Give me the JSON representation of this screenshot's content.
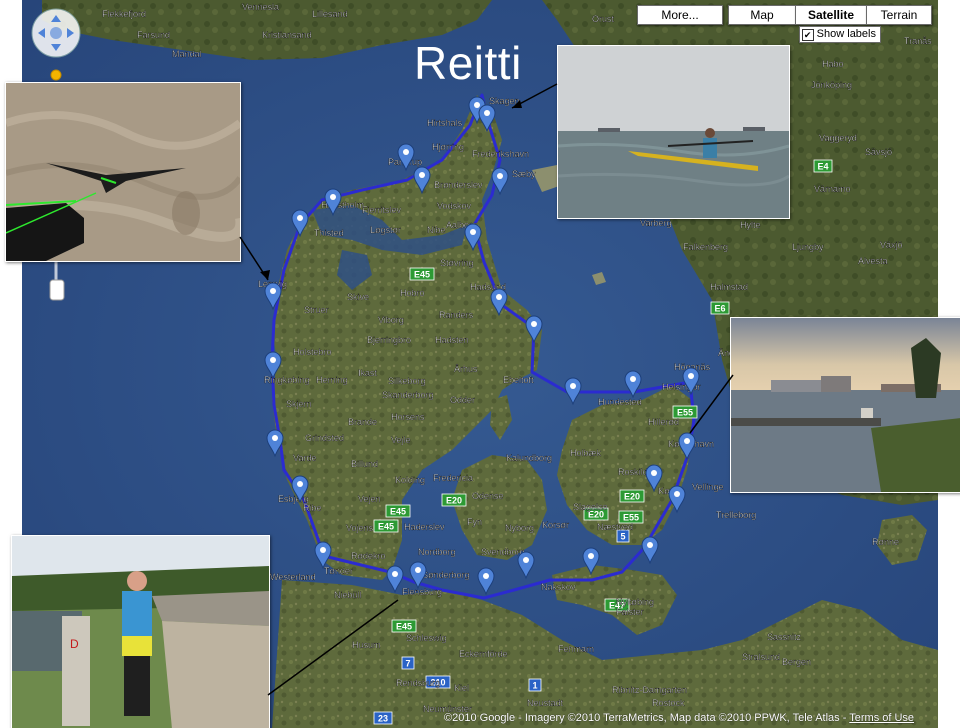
{
  "title": "Reitti",
  "map_controls": {
    "more_label": "More...",
    "map_label": "Map",
    "satellite_label": "Satellite",
    "terrain_label": "Terrain",
    "show_labels_label": "Show labels",
    "show_labels_checked": true,
    "active_type": "Satellite"
  },
  "attribution": {
    "text": "©2010 Google - Imagery ©2010 TerraMetrics, Map data ©2010 PPWK, Tele Atlas - ",
    "terms_link": "Terms of Use"
  },
  "colors": {
    "route": "#2222cc",
    "marker": "#4f83d8",
    "sea": "#2e4f86",
    "land": "#5f6b3c"
  },
  "places": {
    "skagen": "Skagen",
    "hirtshals": "Hirtshals",
    "hjorring": "Hjørring",
    "frederikshavn": "Frederikshavn",
    "saeby": "Sæby",
    "pandrup": "Pandrup",
    "bronderslev": "Brønderslev",
    "vodskov": "Vodskov",
    "aalborg": "Aalborg",
    "fjerritslev": "Fjerritslev",
    "hanstholm": "Hanstholm",
    "thisted": "Thisted",
    "logstor": "Løgstør",
    "nibe": "Nibe",
    "stovring": "Støvring",
    "hadsund": "Hadsund",
    "lemvig": "Lemvig",
    "struer": "Struer",
    "skive": "Skive",
    "hobro": "Hobro",
    "randers": "Randers",
    "holstebro": "Holstebro",
    "viborg": "Viborg",
    "bjerringbro": "Bjerringbro",
    "hadsten": "Hadsten",
    "ringkobing": "Ringkøbing",
    "herning": "Herning",
    "ikast": "Ikast",
    "silkeborg": "Silkeborg",
    "arhus": "Århus",
    "ebeltoft": "Ebeltoft",
    "skjern": "Skjern",
    "skanderborg": "Skanderborg",
    "odder": "Odder",
    "horsens": "Horsens",
    "brande": "Brande",
    "grindsted": "Grindsted",
    "vejle": "Vejle",
    "varde": "Varde",
    "billund": "Billund",
    "kolding": "Kolding",
    "fredericia": "Fredericia",
    "esbjerg": "Esbjerg",
    "ribe": "Ribe",
    "vejen": "Vejen",
    "vojens": "Vojens",
    "haderslev": "Haderslev",
    "odense": "Odense",
    "fyn": "Fyn",
    "nyborg": "Nyborg",
    "svendborg": "Svendborg",
    "nordborg": "Nordborg",
    "sonderborg": "Sønderborg",
    "rodekro": "Rødekro",
    "tonder": "Tønder",
    "westerland": "Westerland",
    "niebull": "Niebüll",
    "flensburg": "Flensburg",
    "schleswig": "Schleswig",
    "husum": "Husum",
    "eckernforde": "Eckernförde",
    "kiel": "Kiel",
    "rendsburg": "Rendsburg",
    "neumunster": "Neumünster",
    "fehmarn": "Fehmarn",
    "neustadt": "Neustadt",
    "rostock": "Rostock",
    "stralsund": "Stralsund",
    "sassnitz": "Sassnitz",
    "bergen": "Bergen",
    "nakskov": "Nakskov",
    "nykobing": "Nykøbing\nFalster",
    "naestved": "Næstved",
    "korsor": "Korsør",
    "slagelse": "Slagelse",
    "kalundborg": "Kalundborg",
    "holbaek": "Holbæk",
    "roskilde": "Roskilde",
    "hillerod": "Hillerød",
    "hundested": "Hundested",
    "helsingor": "Helsingør",
    "hoganas": "Höganäs",
    "angelholm": "Ängelholm",
    "kobenhavn": "København",
    "koge": "Køge",
    "vellinge": "Vellinge",
    "trelleborg": "Trelleborg",
    "ronne": "Rønne",
    "halmstad": "Halmstad",
    "falkenberg": "Falkenberg",
    "varberg": "Varberg",
    "ljungby": "Ljungby",
    "varnamo": "Värnamo",
    "vaxjo": "Växjö",
    "alvesta": "Alvesta",
    "hylte": "Hylte",
    "jonkoping": "Jönköping",
    "vaggeryd": "Vaggeryd",
    "savsjo": "Sävsjö",
    "habo": "Habo",
    "tranas": "Tranås",
    "kristiansand": "Kristiansand",
    "mandal": "Mandal",
    "flekkefjord": "Flekkefjord",
    "farsund": "Farsund",
    "vennesla": "Vennesla",
    "lillesand": "Lillesand",
    "orust": "Orust",
    "rib_ribnitz": "Ribnitz-Damgarten"
  },
  "roads": [
    "E45",
    "E45",
    "E45",
    "E45",
    "E20",
    "E20",
    "E20",
    "E55",
    "E55",
    "E47",
    "E6",
    "E4",
    "210",
    "7",
    "1",
    "23",
    "5"
  ]
}
